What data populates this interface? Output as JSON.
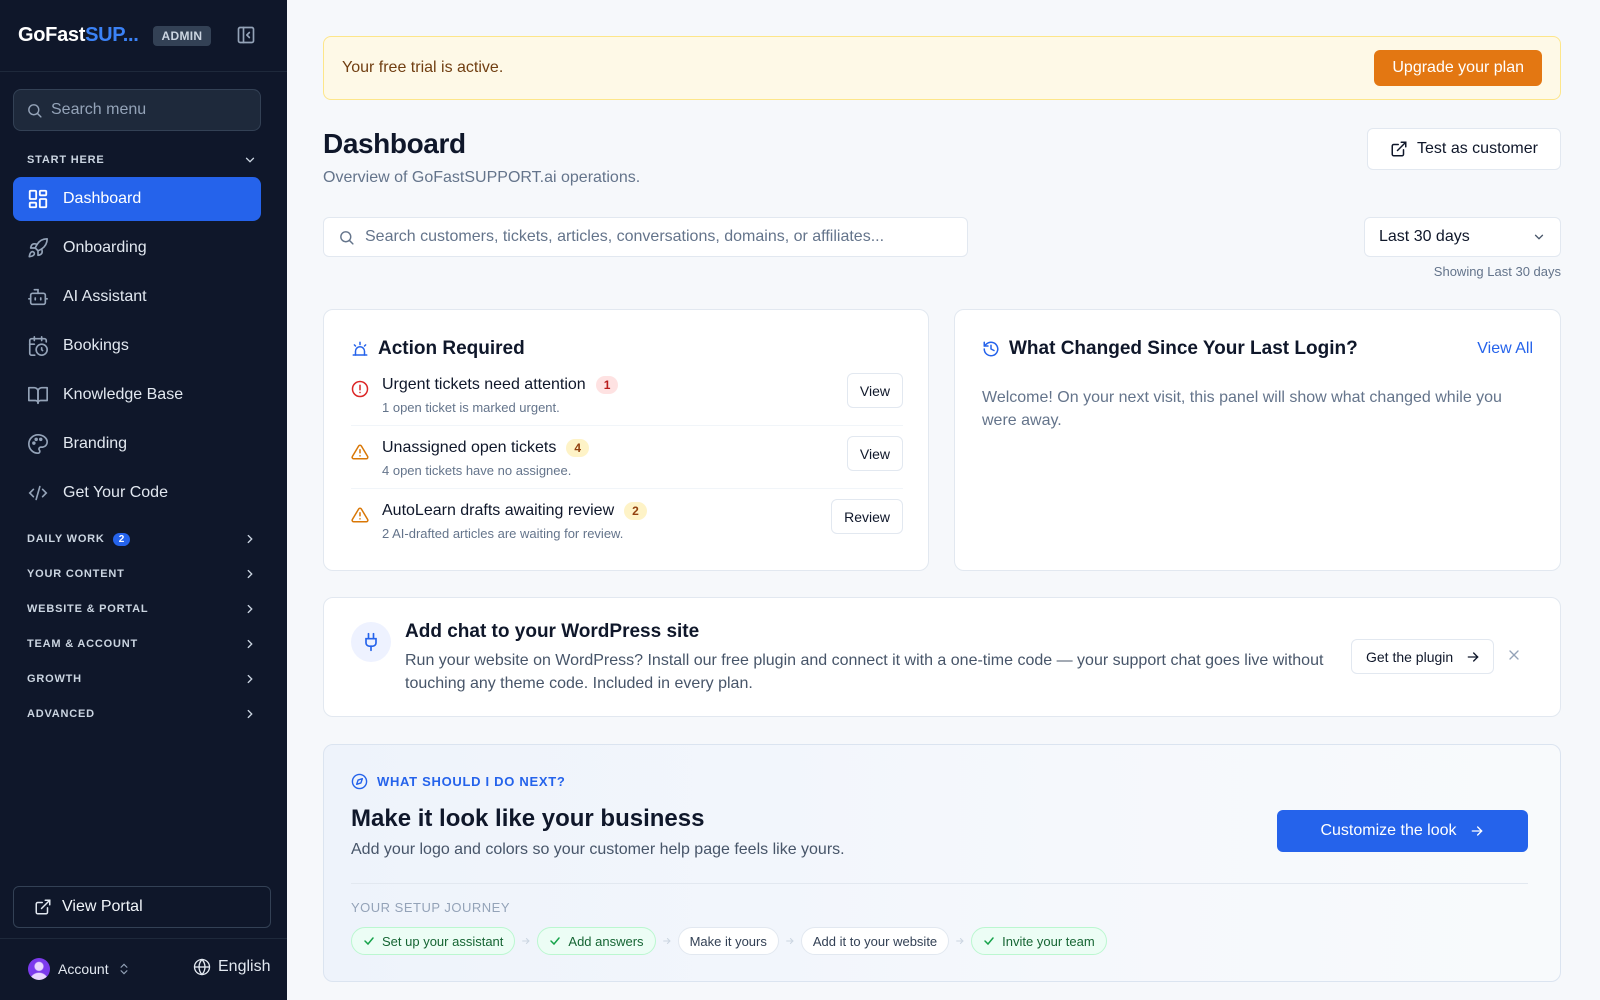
{
  "sidebar": {
    "brand_main": "GoFast",
    "brand_accent": "SUP...",
    "admin_badge": "ADMIN",
    "search_placeholder": "Search menu",
    "start_here": "START HERE",
    "items": [
      {
        "label": "Dashboard",
        "icon": "dashboard-icon",
        "active": true
      },
      {
        "label": "Onboarding",
        "icon": "rocket-icon"
      },
      {
        "label": "AI Assistant",
        "icon": "bot-icon"
      },
      {
        "label": "Bookings",
        "icon": "calendar-clock-icon"
      },
      {
        "label": "Knowledge Base",
        "icon": "book-open-icon"
      },
      {
        "label": "Branding",
        "icon": "palette-icon"
      },
      {
        "label": "Get Your Code",
        "icon": "code-icon"
      }
    ],
    "sections": [
      {
        "label": "DAILY WORK",
        "count": "2"
      },
      {
        "label": "YOUR CONTENT"
      },
      {
        "label": "WEBSITE & PORTAL"
      },
      {
        "label": "TEAM & ACCOUNT"
      },
      {
        "label": "GROWTH"
      },
      {
        "label": "ADVANCED"
      }
    ],
    "view_portal": "View Portal",
    "account": "Account",
    "language": "English"
  },
  "trial": {
    "message": "Your free trial is active.",
    "upgrade_label": "Upgrade your plan"
  },
  "header": {
    "title": "Dashboard",
    "subtitle": "Overview of GoFastSUPPORT.ai operations.",
    "test_label": "Test as customer",
    "search_placeholder": "Search customers, tickets, articles, conversations, domains, or affiliates...",
    "range_value": "Last 30 days",
    "range_note": "Showing Last 30 days"
  },
  "action_required": {
    "title": "Action Required",
    "items": [
      {
        "title": "Urgent tickets need attention",
        "count": "1",
        "desc": "1 open ticket is marked urgent.",
        "button": "View",
        "severity": "urgent"
      },
      {
        "title": "Unassigned open tickets",
        "count": "4",
        "desc": "4 open tickets have no assignee.",
        "button": "View",
        "severity": "warning"
      },
      {
        "title": "AutoLearn drafts awaiting review",
        "count": "2",
        "desc": "2 AI-drafted articles are waiting for review.",
        "button": "Review",
        "severity": "warning"
      }
    ]
  },
  "changes": {
    "title": "What Changed Since Your Last Login?",
    "view_all": "View All",
    "message": "Welcome! On your next visit, this panel will show what changed while you were away."
  },
  "wordpress": {
    "title": "Add chat to your WordPress site",
    "desc": "Run your website on WordPress? Install our free plugin and connect it with a one-time code — your support chat goes live without touching any theme code. Included in every plan.",
    "button": "Get the plugin"
  },
  "next": {
    "eyebrow": "WHAT SHOULD I DO NEXT?",
    "title": "Make it look like your business",
    "desc": "Add your logo and colors so your customer help page feels like yours.",
    "button": "Customize the look",
    "journey_label": "YOUR SETUP JOURNEY",
    "steps": [
      {
        "label": "Set up your assistant",
        "done": true
      },
      {
        "label": "Add answers",
        "done": true
      },
      {
        "label": "Make it yours",
        "done": false
      },
      {
        "label": "Add it to your website",
        "done": false
      },
      {
        "label": "Invite your team",
        "done": true
      }
    ]
  },
  "colors": {
    "sidebar_bg": "#0f172a",
    "accent": "#2563eb",
    "upgrade": "#e37712",
    "success": "#166534"
  }
}
